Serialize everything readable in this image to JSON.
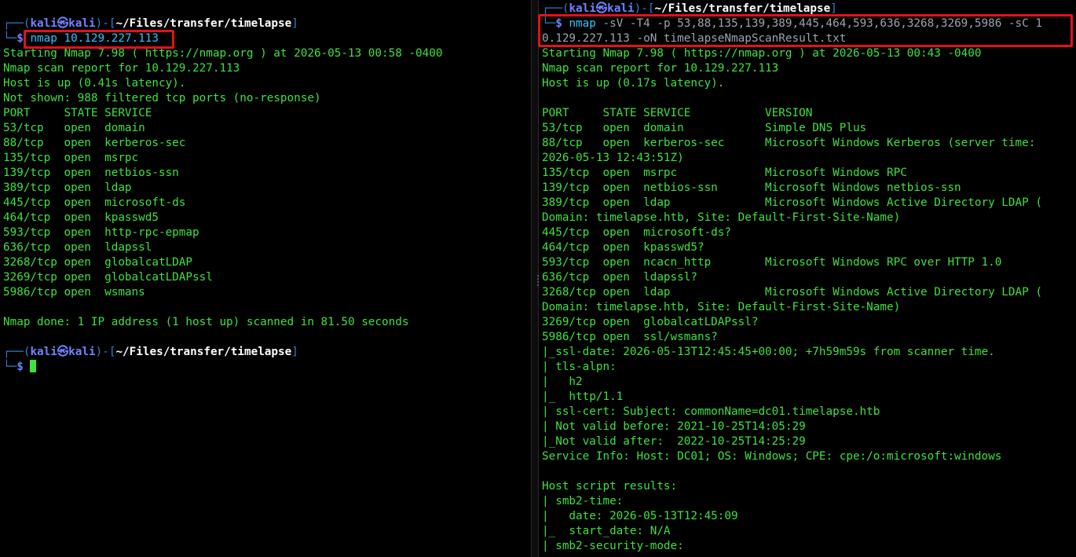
{
  "colors": {
    "background": "#000000",
    "output": "#3ee13e",
    "prompt_user": "#6f83ff",
    "prompt_frame": "#2f7fd6",
    "command": "#2fc3ff",
    "highlight_box": "#e0121b"
  },
  "left": {
    "prompt1": {
      "frame_open": "┌──(",
      "user": "kali㉿kali",
      "frame_mid": ")-[",
      "path": "~/Files/transfer/timelapse",
      "frame_close": "]",
      "prompt_leader": "└─",
      "dollar": "$",
      "command": "nmap",
      "args": "10.129.227.113"
    },
    "output": [
      "Starting Nmap 7.98 ( https://nmap.org ) at 2026-05-13 00:58 -0400",
      "Nmap scan report for 10.129.227.113",
      "Host is up (0.41s latency).",
      "Not shown: 988 filtered tcp ports (no-response)",
      "PORT     STATE SERVICE",
      "53/tcp   open  domain",
      "88/tcp   open  kerberos-sec",
      "135/tcp  open  msrpc",
      "139/tcp  open  netbios-ssn",
      "389/tcp  open  ldap",
      "445/tcp  open  microsoft-ds",
      "464/tcp  open  kpasswd5",
      "593/tcp  open  http-rpc-epmap",
      "636/tcp  open  ldapssl",
      "3268/tcp open  globalcatLDAP",
      "3269/tcp open  globalcatLDAPssl",
      "5986/tcp open  wsmans",
      "",
      "Nmap done: 1 IP address (1 host up) scanned in 81.50 seconds",
      ""
    ],
    "prompt2": {
      "frame_open": "┌──(",
      "user": "kali㉿kali",
      "frame_mid": ")-[",
      "path": "~/Files/transfer/timelapse",
      "frame_close": "]",
      "prompt_leader": "└─",
      "dollar": "$"
    }
  },
  "right": {
    "prompt": {
      "frame_open": "┌──(",
      "user": "kali㉿kali",
      "frame_mid": ")-[",
      "path": "~/Files/transfer/timelapse",
      "frame_close": "]",
      "prompt_leader": "└─",
      "dollar": "$",
      "command": "nmap",
      "args_line1": "-sV -T4 -p 53,88,135,139,389,445,464,593,636,3268,3269,5986 -sC 1",
      "args_line2": "0.129.227.113 -oN timelapseNmapScanResult.txt"
    },
    "output": [
      "Starting Nmap 7.98 ( https://nmap.org ) at 2026-05-13 00:43 -0400",
      "Nmap scan report for 10.129.227.113",
      "Host is up (0.17s latency).",
      "",
      "PORT     STATE SERVICE           VERSION",
      "53/tcp   open  domain            Simple DNS Plus",
      "88/tcp   open  kerberos-sec      Microsoft Windows Kerberos (server time:",
      "2026-05-13 12:43:51Z)",
      "135/tcp  open  msrpc             Microsoft Windows RPC",
      "139/tcp  open  netbios-ssn       Microsoft Windows netbios-ssn",
      "389/tcp  open  ldap              Microsoft Windows Active Directory LDAP (",
      "Domain: timelapse.htb, Site: Default-First-Site-Name)",
      "445/tcp  open  microsoft-ds?",
      "464/tcp  open  kpasswd5?",
      "593/tcp  open  ncacn_http        Microsoft Windows RPC over HTTP 1.0",
      "636/tcp  open  ldapssl?",
      "3268/tcp open  ldap              Microsoft Windows Active Directory LDAP (",
      "Domain: timelapse.htb, Site: Default-First-Site-Name)",
      "3269/tcp open  globalcatLDAPssl?",
      "5986/tcp open  ssl/wsmans?",
      "|_ssl-date: 2026-05-13T12:45:45+00:00; +7h59m59s from scanner time.",
      "| tls-alpn:",
      "|   h2",
      "|_  http/1.1",
      "| ssl-cert: Subject: commonName=dc01.timelapse.htb",
      "| Not valid before: 2021-10-25T14:05:29",
      "|_Not valid after:  2022-10-25T14:25:29",
      "Service Info: Host: DC01; OS: Windows; CPE: cpe:/o:microsoft:windows",
      "",
      "Host script results:",
      "| smb2-time:",
      "|   date: 2026-05-13T12:45:09",
      "|_  start_date: N/A",
      "| smb2-security-mode:"
    ]
  }
}
